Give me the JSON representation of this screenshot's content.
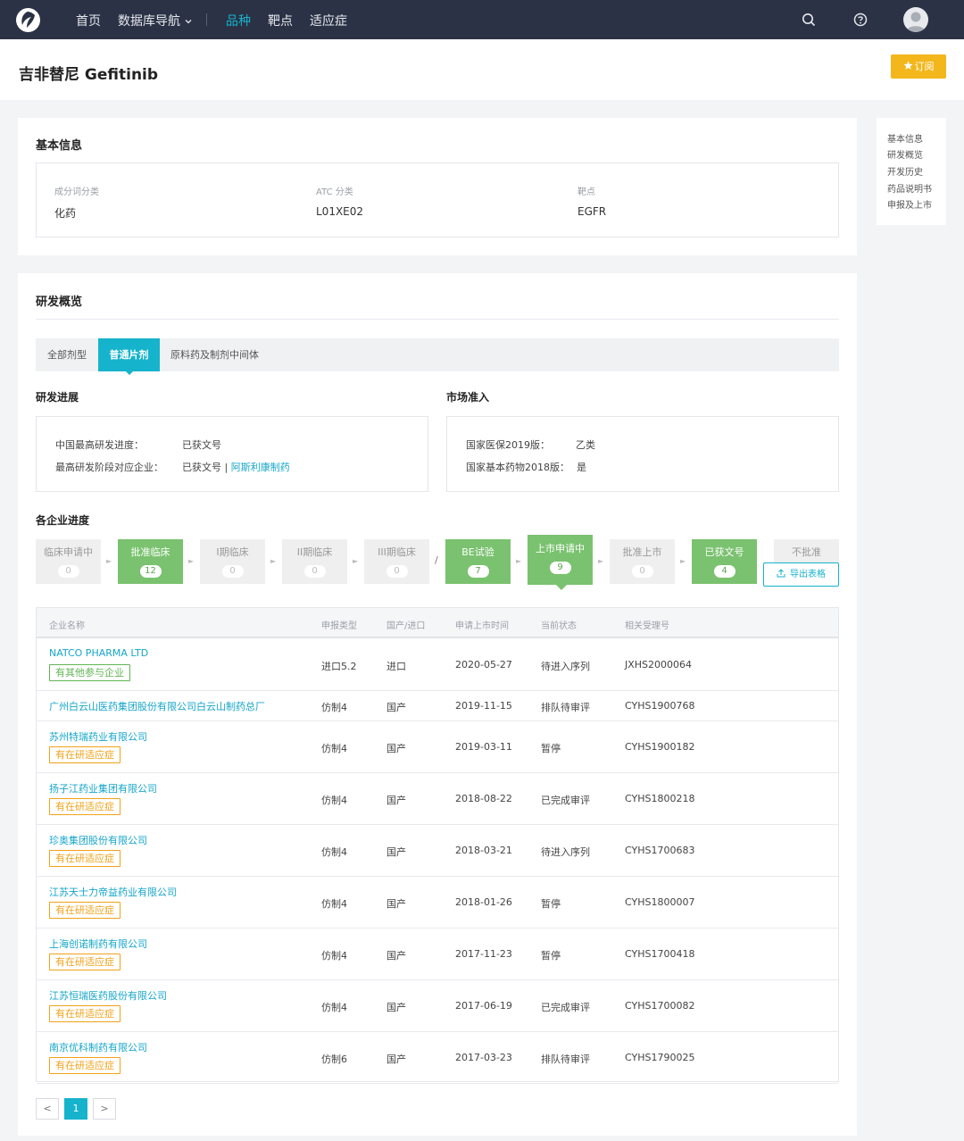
{
  "nav": {
    "items": [
      "首页",
      "数据库导航",
      "品种",
      "靶点",
      "适应症"
    ],
    "dropdown_icon": "chevron-down-icon",
    "active": "品种",
    "icons": [
      "search-icon",
      "help-icon",
      "avatar"
    ]
  },
  "page": {
    "title": "吉非替尼 Gefitinib",
    "subscribe_label": "订阅",
    "subscribe_icon": "star-icon"
  },
  "toc": [
    "基本信息",
    "研发概览",
    "开发历史",
    "药品说明书",
    "申报及上市"
  ],
  "basic": {
    "title": "基本信息",
    "fields": [
      {
        "label": "成分词分类",
        "value": "化药"
      },
      {
        "label": "ATC 分类",
        "value": "L01XE02"
      },
      {
        "label": "靶点",
        "value": "EGFR"
      }
    ]
  },
  "overview": {
    "title": "研发概览",
    "tabs": [
      "全部剂型",
      "普通片剂",
      "原料药及制剂中间体"
    ],
    "active_tab": "普通片剂",
    "progress": {
      "title": "研发进展",
      "rows": [
        {
          "label": "中国最高研发进度：",
          "value": "已获文号"
        },
        {
          "label": "最高研发阶段对应企业：",
          "value": "已获文号 | ",
          "link": "阿斯利康制药"
        }
      ]
    },
    "market": {
      "title": "市场准入",
      "rows": [
        {
          "label": "国家医保2019版：",
          "value": "乙类"
        },
        {
          "label": "国家基本药物2018版：",
          "value": "是"
        }
      ]
    }
  },
  "company_progress": {
    "title": "各企业进度",
    "stages": [
      {
        "name": "临床申请中",
        "count": "0",
        "active": false
      },
      {
        "name": "批准临床",
        "count": "12",
        "active": true
      },
      {
        "name": "I期临床",
        "count": "0",
        "active": false
      },
      {
        "name": "II期临床",
        "count": "0",
        "active": false
      },
      {
        "name": "III期临床",
        "count": "0",
        "active": false
      },
      {
        "name": "BE试验",
        "count": "7",
        "active": true
      },
      {
        "name": "上市申请中",
        "count": "9",
        "active": true
      },
      {
        "name": "批准上市",
        "count": "0",
        "active": false
      },
      {
        "name": "已获文号",
        "count": "4",
        "active": true
      }
    ],
    "separator": "/",
    "not_approved": "不批准",
    "export_label": "导出表格",
    "export_icon": "export-icon"
  },
  "table": {
    "headers": [
      "企业名称",
      "申报类型",
      "国产/进口",
      "申请上市时间",
      "当前状态",
      "相关受理号"
    ],
    "rows": [
      {
        "company": "NATCO PHARMA LTD",
        "tag": "有其他参与企业",
        "tag_color": "#62b455",
        "type": "进口5.2",
        "origin": "进口",
        "date": "2020-05-27",
        "status": "待进入序列",
        "code": "JXHS2000064"
      },
      {
        "company": "广州白云山医药集团股份有限公司白云山制药总厂",
        "tag": "",
        "tag_color": "",
        "type": "仿制4",
        "origin": "国产",
        "date": "2019-11-15",
        "status": "排队待审评",
        "code": "CYHS1900768"
      },
      {
        "company": "苏州特瑞药业有限公司",
        "tag": "有在研适应症",
        "tag_color": "#f0a21a",
        "type": "仿制4",
        "origin": "国产",
        "date": "2019-03-11",
        "status": "暂停",
        "code": "CYHS1900182"
      },
      {
        "company": "扬子江药业集团有限公司",
        "tag": "有在研适应症",
        "tag_color": "#f0a21a",
        "type": "仿制4",
        "origin": "国产",
        "date": "2018-08-22",
        "status": "已完成审评",
        "code": "CYHS1800218"
      },
      {
        "company": "珍奥集团股份有限公司",
        "tag": "有在研适应症",
        "tag_color": "#f0a21a",
        "type": "仿制4",
        "origin": "国产",
        "date": "2018-03-21",
        "status": "待进入序列",
        "code": "CYHS1700683"
      },
      {
        "company": "江苏天士力帝益药业有限公司",
        "tag": "有在研适应症",
        "tag_color": "#f0a21a",
        "type": "仿制4",
        "origin": "国产",
        "date": "2018-01-26",
        "status": "暂停",
        "code": "CYHS1800007"
      },
      {
        "company": "上海创诺制药有限公司",
        "tag": "有在研适应症",
        "tag_color": "#f0a21a",
        "type": "仿制4",
        "origin": "国产",
        "date": "2017-11-23",
        "status": "暂停",
        "code": "CYHS1700418"
      },
      {
        "company": "江苏恒瑞医药股份有限公司",
        "tag": "有在研适应症",
        "tag_color": "#f0a21a",
        "type": "仿制4",
        "origin": "国产",
        "date": "2017-06-19",
        "status": "已完成审评",
        "code": "CYHS1700082"
      },
      {
        "company": "南京优科制药有限公司",
        "tag": "有在研适应症",
        "tag_color": "#f0a21a",
        "type": "仿制6",
        "origin": "国产",
        "date": "2017-03-23",
        "status": "排队待审评",
        "code": "CYHS1790025"
      }
    ]
  },
  "pagination": {
    "prev": "<",
    "current": "1",
    "next": ">"
  },
  "colors": {
    "accent": "#16b3cc",
    "nav_bg": "#2b3245",
    "stage_active": "#7ac26f",
    "subscribe": "#f3b71c",
    "link": "#16a6c9"
  }
}
